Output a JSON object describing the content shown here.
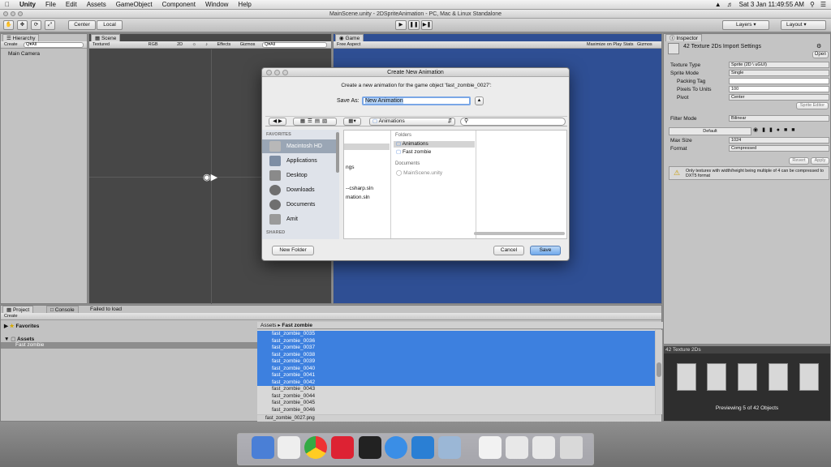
{
  "menubar": {
    "app": "Unity",
    "items": [
      "File",
      "Edit",
      "Assets",
      "GameObject",
      "Component",
      "Window",
      "Help"
    ],
    "clock": "Sat 3 Jan  11:49:55 AM"
  },
  "window_title": "MainScene.unity - 2DSpriteAnimation - PC, Mac & Linux Standalone",
  "toolbar": {
    "center": "Center",
    "local": "Local",
    "layers": "Layers",
    "layout": "Layout"
  },
  "hierarchy": {
    "tab": "Hierarchy",
    "create": "Create",
    "search": "Q▾All",
    "items": [
      "Main Camera"
    ]
  },
  "scene": {
    "tab": "Scene",
    "shading": "Textured",
    "rgb": "RGB",
    "mode2d": "2D",
    "effects": "Effects",
    "gizmos": "Gizmos",
    "search": "Q▾All"
  },
  "game": {
    "tab": "Game",
    "aspect": "Free Aspect",
    "maximize": "Maximize on Play",
    "stats": "Stats",
    "gizmos": "Gizmos"
  },
  "inspector": {
    "tab": "Inspector",
    "title": "42 Texture 2Ds Import Settings",
    "open": "Open",
    "fields": [
      {
        "label": "Texture Type",
        "value": "Sprite (2D \\ uGUI)"
      },
      {
        "label": "Sprite Mode",
        "value": "Single"
      },
      {
        "label": "Packing Tag",
        "value": ""
      },
      {
        "label": "Pixels To Units",
        "value": "100"
      },
      {
        "label": "Pivot",
        "value": "Center"
      }
    ],
    "sprite_editor": "Sprite Editor",
    "filter_mode_label": "Filter Mode",
    "filter_mode": "Bilinear",
    "platform_default": "Default",
    "max_size_label": "Max Size",
    "max_size": "1024",
    "format_label": "Format",
    "format": "Compressed",
    "revert": "Revert",
    "apply": "Apply",
    "warning": "Only textures with width/height being multiple of 4 can be compressed to DXT5 format"
  },
  "preview": {
    "title": "42 Texture 2Ds",
    "caption": "Previewing 5 of 42 Objects"
  },
  "project": {
    "tab": "Project",
    "console_tab": "Console",
    "status": "Failed to load",
    "create": "Create",
    "favorites": "Favorites",
    "assets": "Assets",
    "fast_zombie": "Fast zombie",
    "breadcrumb_root": "Assets",
    "breadcrumb_leaf": "Fast zombie",
    "files_selected": [
      "fast_zombie_0035",
      "fast_zombie_0036",
      "fast_zombie_0037",
      "fast_zombie_0038",
      "fast_zombie_0039",
      "fast_zombie_0040",
      "fast_zombie_0041",
      "fast_zombie_0042"
    ],
    "files": [
      "fast_zombie_0043",
      "fast_zombie_0044",
      "fast_zombie_0045",
      "fast_zombie_0046"
    ],
    "footer": "fast_zombie_0027.png"
  },
  "dialog": {
    "title": "Create New Animation",
    "message": "Create a new animation for the game object 'fast_zombie_0027':",
    "save_as_label": "Save As:",
    "save_as_value": "New Animation",
    "location": "Animations",
    "favorites_header": "FAVORITES",
    "shared_header": "SHARED",
    "sidebar": [
      "Macintosh HD",
      "Applications",
      "Desktop",
      "Downloads",
      "Documents",
      "Amit"
    ],
    "col1_fragments": [
      "ngs",
      "--csharp.sln",
      "mation.sln"
    ],
    "folders_header": "Folders",
    "folders": [
      "Animations",
      "Fast zombie"
    ],
    "documents_header": "Documents",
    "documents": [
      "MainScene.unity"
    ],
    "new_folder": "New Folder",
    "cancel": "Cancel",
    "save": "Save"
  },
  "colors": {
    "selection": "#3d80df",
    "game_bg": "#2f4f94",
    "scene_bg": "#474747",
    "panel": "#c2c2c2"
  }
}
